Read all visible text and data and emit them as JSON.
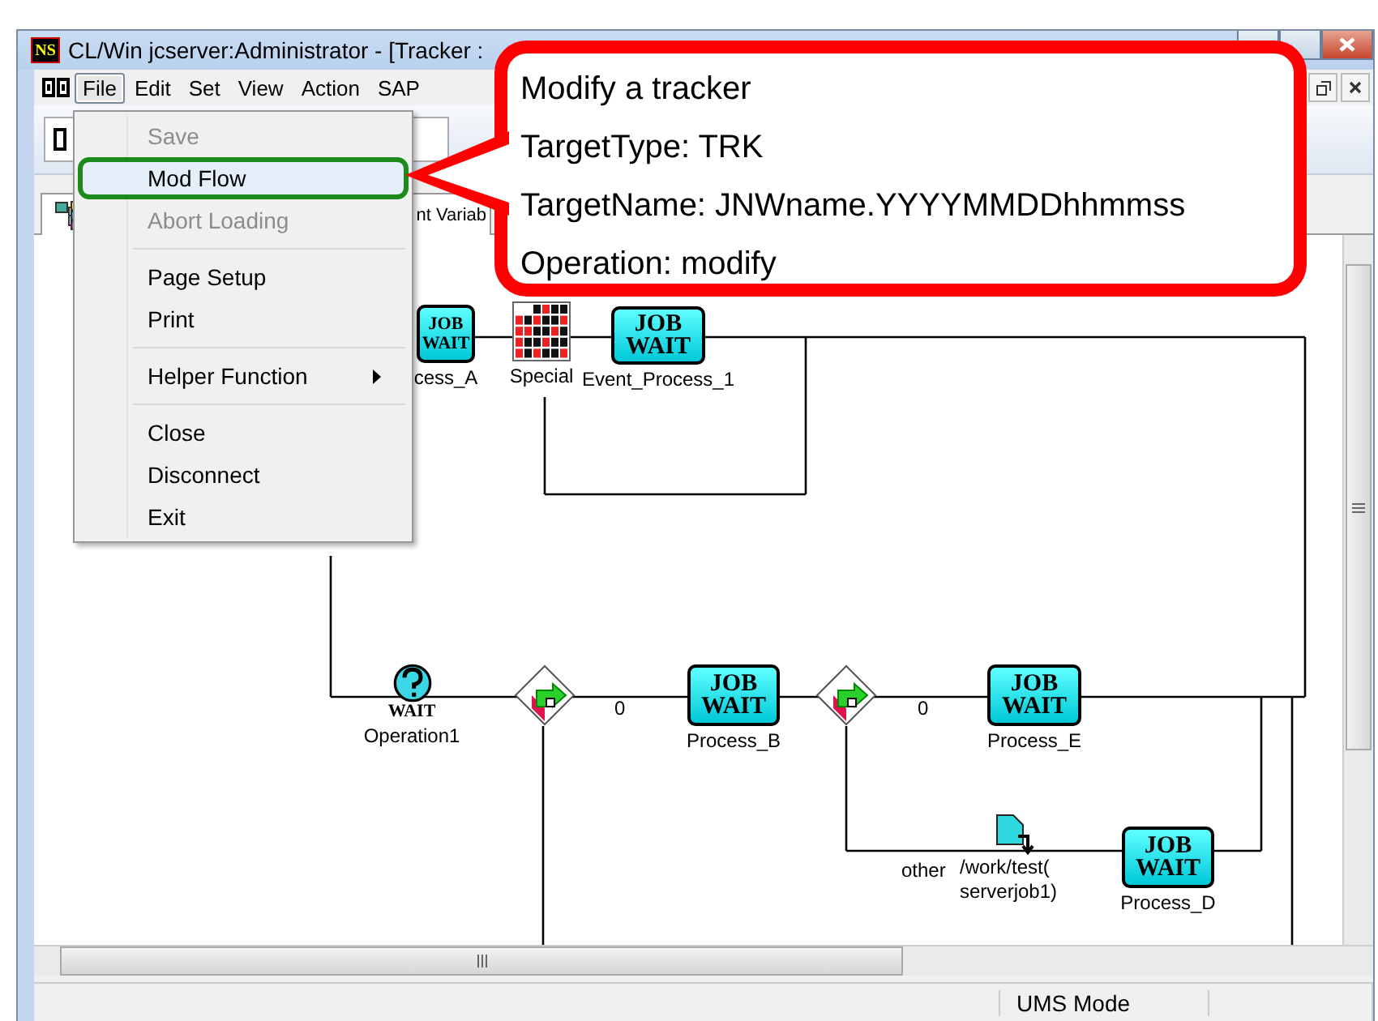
{
  "window": {
    "app_icon_text": "NS",
    "title": "CL/Win jcserver:Administrator - [Tracker :"
  },
  "menu_bar": {
    "items": [
      {
        "label": "File",
        "selected": true
      },
      {
        "label": "Edit",
        "selected": false
      },
      {
        "label": "Set",
        "selected": false
      },
      {
        "label": "View",
        "selected": false
      },
      {
        "label": "Action",
        "selected": false
      },
      {
        "label": "SAP",
        "selected": false
      }
    ]
  },
  "tab": {
    "label": "nt Variab"
  },
  "file_menu": {
    "items": [
      {
        "kind": "item",
        "label": "Save",
        "disabled": true,
        "highlighted": false
      },
      {
        "kind": "item",
        "label": "Mod Flow",
        "disabled": false,
        "highlighted": true
      },
      {
        "kind": "item",
        "label": "Abort Loading",
        "disabled": true,
        "highlighted": false
      },
      {
        "kind": "separator"
      },
      {
        "kind": "item",
        "label": "Page Setup",
        "disabled": false,
        "highlighted": false
      },
      {
        "kind": "item",
        "label": "Print",
        "disabled": false,
        "highlighted": false
      },
      {
        "kind": "separator"
      },
      {
        "kind": "submenu",
        "label": "Helper Function",
        "disabled": false,
        "highlighted": false
      },
      {
        "kind": "separator"
      },
      {
        "kind": "item",
        "label": "Close",
        "disabled": false,
        "highlighted": false
      },
      {
        "kind": "item",
        "label": "Disconnect",
        "disabled": false,
        "highlighted": false
      },
      {
        "kind": "item",
        "label": "Exit",
        "disabled": false,
        "highlighted": false
      }
    ]
  },
  "callout": {
    "lines": [
      "Modify a tracker",
      "TargetType: TRK",
      "TargetName: JNWname.YYYYMMDDhhmmss",
      "Operation: modify"
    ]
  },
  "flow": {
    "nodes": [
      {
        "kind": "job",
        "label": "cess_A",
        "icon_text": [
          "JOB",
          "WAIT"
        ]
      },
      {
        "kind": "calendar",
        "label": "Special"
      },
      {
        "kind": "job",
        "label": "Event_Process_1",
        "icon_text": [
          "JOB",
          "WAIT"
        ]
      },
      {
        "kind": "wait",
        "label": "Operation1",
        "icon_text": [
          "WAIT"
        ]
      },
      {
        "kind": "branch"
      },
      {
        "kind": "edge_label",
        "label": "0"
      },
      {
        "kind": "job",
        "label": "Process_B",
        "icon_text": [
          "JOB",
          "WAIT"
        ]
      },
      {
        "kind": "branch"
      },
      {
        "kind": "edge_label",
        "label": "0"
      },
      {
        "kind": "job",
        "label": "Process_E",
        "icon_text": [
          "JOB",
          "WAIT"
        ]
      },
      {
        "kind": "edge_label",
        "label": "other"
      },
      {
        "kind": "file",
        "label_lines": [
          "/work/test(",
          "serverjob1)"
        ]
      },
      {
        "kind": "job",
        "label": "Process_D",
        "icon_text": [
          "JOB",
          "WAIT"
        ]
      }
    ]
  },
  "status_bar": {
    "mode": "UMS Mode"
  }
}
